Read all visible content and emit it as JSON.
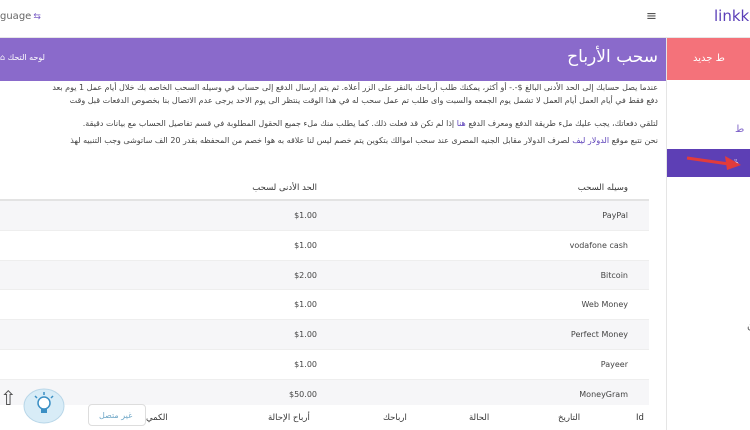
{
  "topbar": {
    "language": "guage",
    "brand": "linkkav"
  },
  "sidebar": {
    "new_link": "ط جديد",
    "link_partial": "ط",
    "active_partial": "ة",
    "mark": "ن"
  },
  "panel": {
    "title": "سحب الأرباح",
    "dashboard": "لوحه التحك",
    "para1": "عندما يصل حسابك إلى الحد الأدنى البالغ $-.- أو أكثر، يمكنك طلب أرباحك بالنقر على الزر أعلاه. ثم يتم إرسال الدفع إلى حساب في وسيله السحب الخاصه بك خلال أيام عمل 1 يوم بعد",
    "para2": "دفع فقط في أيام العمل أيام العمل لا تشمل يوم الجمعه والسبت واى طلب تم عمل سحب له في هذا الوقت ينتظر الى يوم الاحد يرجى عدم الاتصال بنا بخصوص الدفعات قبل وقت",
    "para3_a": "لتلقي دفعاتك، يجب عليك ملء طريقة الدفع ومعرف الدفع",
    "para3_link": "هنا",
    "para3_b": "إذا لم تكن قد فعلت ذلك. كما يطلب منك ملء جميع الحقول المطلوبة في قسم تفاصيل الحساب مع بيانات دقيقة.",
    "para4_a": "نحن نتبع موقع",
    "para4_link": "الدولار ليف",
    "para4_b": "لصرف الدولار مقابل الجنيه المصرى عند سحب اموالك بتكوين يتم خصم ليس لنا علاقه به هوا خصم من المحفظه بقدر 20 الف ساتوشى وجب التنبيه لهذ"
  },
  "table": {
    "headers": {
      "method": "وسيله السحب",
      "min": "الحد الأدنى لسحب"
    },
    "rows": [
      {
        "method": "PayPal",
        "min": "$1.00"
      },
      {
        "method": "vodafone cash",
        "min": "$1.00"
      },
      {
        "method": "Bitcoin",
        "min": "$2.00"
      },
      {
        "method": "Web Money",
        "min": "$1.00"
      },
      {
        "method": "Perfect Money",
        "min": "$1.00"
      },
      {
        "method": "Payeer",
        "min": "$1.00"
      },
      {
        "method": "MoneyGram",
        "min": "$50.00"
      }
    ]
  },
  "footer_table": {
    "id": "Id",
    "date": "التاريخ",
    "status": "الحالة",
    "earnings": "ارباحك",
    "referral": "أرباح الإحالة",
    "amount": "الكمي"
  },
  "chat": {
    "label": "غير متصل"
  }
}
